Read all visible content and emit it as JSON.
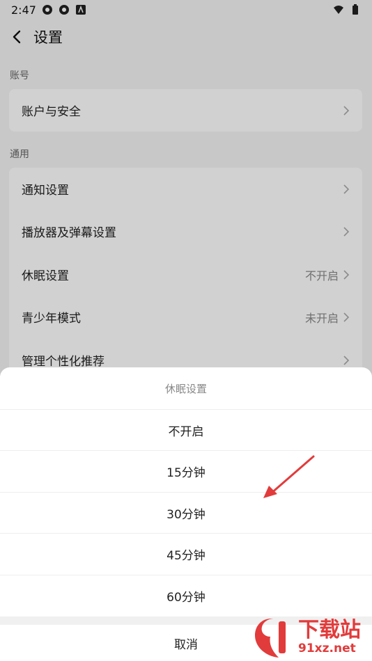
{
  "status_bar": {
    "time": "2:47"
  },
  "header": {
    "title": "设置"
  },
  "sections": [
    {
      "label": "账号",
      "items": [
        {
          "label": "账户与安全",
          "value": ""
        }
      ]
    },
    {
      "label": "通用",
      "items": [
        {
          "label": "通知设置",
          "value": ""
        },
        {
          "label": "播放器及弹幕设置",
          "value": ""
        },
        {
          "label": "休眠设置",
          "value": "不开启"
        },
        {
          "label": "青少年模式",
          "value": "未开启"
        },
        {
          "label": "管理个性化推荐",
          "value": ""
        }
      ]
    }
  ],
  "sheet": {
    "title": "休眠设置",
    "options": [
      "不开启",
      "15分钟",
      "30分钟",
      "45分钟",
      "60分钟"
    ],
    "cancel": "取消"
  },
  "watermark": {
    "main": "下载站",
    "sub": "91xz.net"
  },
  "colors": {
    "accent_red": "#e23b3b",
    "overlay": "rgba(0,0,0,0.18)"
  }
}
